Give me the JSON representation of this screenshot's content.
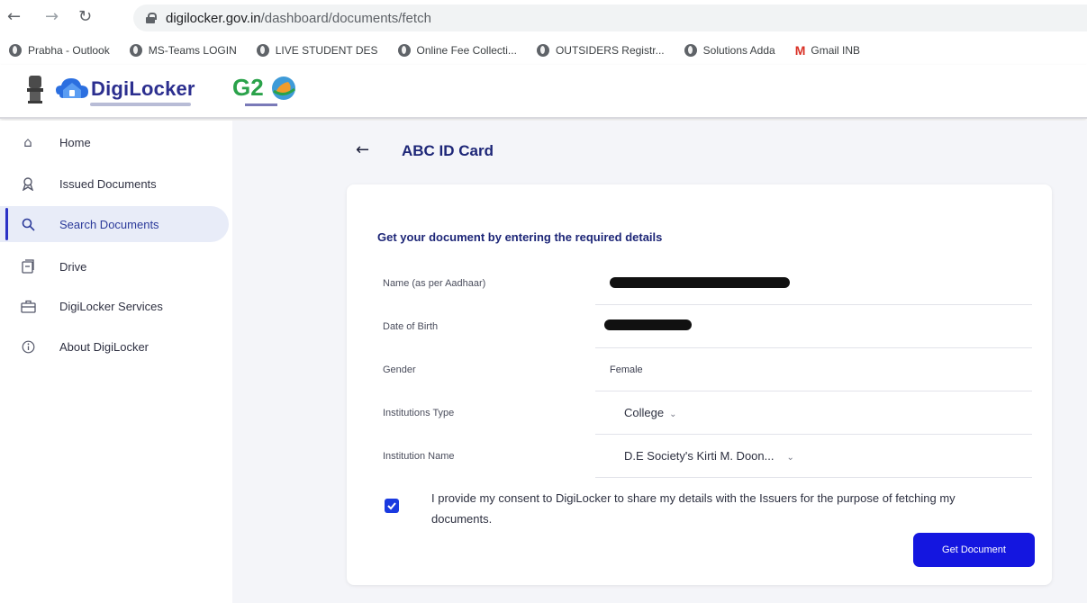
{
  "browser": {
    "url_host": "digilocker.gov.in",
    "url_path": "/dashboard/documents/fetch",
    "bookmarks": [
      {
        "label": "Prabha - Outlook",
        "icon": "globe-icon"
      },
      {
        "label": "MS-Teams LOGIN",
        "icon": "globe-icon"
      },
      {
        "label": "LIVE STUDENT DES",
        "icon": "globe-icon"
      },
      {
        "label": "Online Fee Collecti...",
        "icon": "globe-icon"
      },
      {
        "label": "OUTSIDERS Registr...",
        "icon": "globe-icon"
      },
      {
        "label": "Solutions Adda",
        "icon": "globe-icon"
      },
      {
        "label": "Gmail INB",
        "icon": "gmail-icon"
      }
    ]
  },
  "header": {
    "brand": "DigiLocker",
    "g20": "G2"
  },
  "sidebar": {
    "items": [
      {
        "label": "Home",
        "icon": "home-icon",
        "active": false
      },
      {
        "label": "Issued Documents",
        "icon": "issued-documents-icon",
        "active": false
      },
      {
        "label": "Search Documents",
        "icon": "search-icon",
        "active": true
      },
      {
        "label": "Drive",
        "icon": "drive-icon",
        "active": false
      },
      {
        "label": "DigiLocker Services",
        "icon": "briefcase-icon",
        "active": false
      },
      {
        "label": "About DigiLocker",
        "icon": "info-icon",
        "active": false
      }
    ]
  },
  "main": {
    "title": "ABC ID Card",
    "heading": "Get your document by entering the required details",
    "fields": {
      "name_label": "Name (as per Aadhaar)",
      "dob_label": "Date of Birth",
      "gender_label": "Gender",
      "gender_value": "Female",
      "inst_type_label": "Institutions Type",
      "inst_type_value": "College",
      "inst_name_label": "Institution Name",
      "inst_name_value": "D.E Society's Kirti M. Doon..."
    },
    "consent_checked": true,
    "consent_text": "I provide my consent to DigiLocker to share my details with the Issuers for the purpose of fetching my documents.",
    "button": "Get Document"
  },
  "colors": {
    "brand_navy": "#1d2677",
    "button_blue": "#1416e0",
    "active_bg": "#e8ecf8"
  }
}
